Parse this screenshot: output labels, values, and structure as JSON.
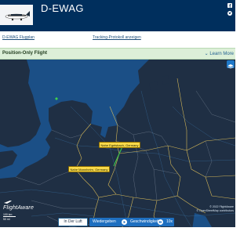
{
  "header": {
    "registration": "D-EWAG",
    "icons": [
      "facebook-icon",
      "twitter-icon"
    ]
  },
  "links": {
    "flights": "D-EWAG Flugplan",
    "tracklog": "Tracking-Protokoll anzeigen"
  },
  "banner": {
    "title": "Position-Only Flight",
    "learn_more": "Learn More",
    "color": "#dcefd8"
  },
  "map": {
    "origin_label": "Nahe Egelsbach, Germany",
    "destination_label": "Nahe Mannheim, Germany",
    "logo": "FlightAware",
    "scale_km": "100 km",
    "scale_mi": "50 mi",
    "attribution_line1": "© 2022 FlightAware",
    "attribution_line2": "© OpenStreetMap contributors",
    "land_color": "#1f2f44",
    "sea_color": "#1b4f86",
    "route_color": "#3fd24a"
  },
  "controls": {
    "live": "In Der Luft",
    "replay": "Wiedergeben",
    "speed_label": "Geschwindigkeit",
    "speed_value": "10x"
  }
}
